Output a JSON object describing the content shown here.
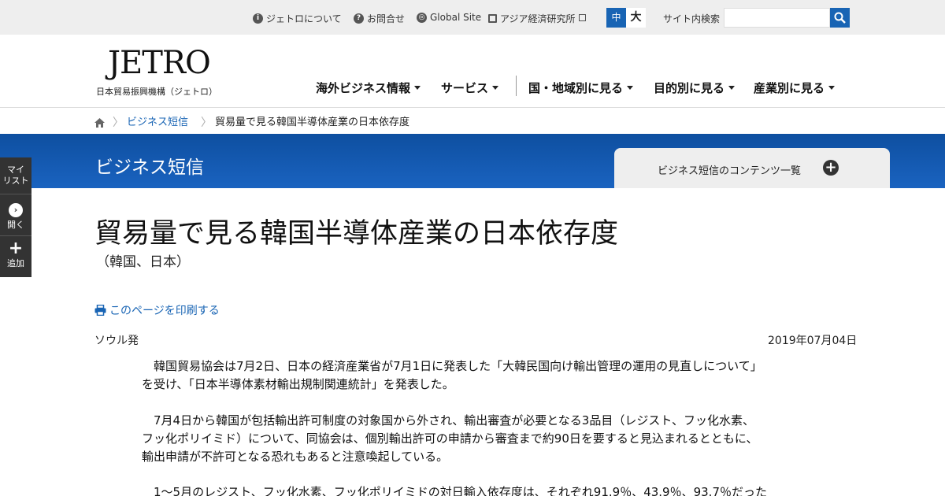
{
  "topbar": {
    "about": "ジェトロについて",
    "contact": "お問合せ",
    "global": "Global Site",
    "ide": "アジア経済研究所",
    "font_mid": "中",
    "font_big": "大",
    "search_label": "サイト内検索",
    "search_value": ""
  },
  "logo": {
    "word": "JETRO",
    "sub": "日本貿易振興機構（ジェトロ）"
  },
  "nav": [
    "海外ビジネス情報",
    "サービス",
    "国・地域別に見る",
    "目的別に見る",
    "産業別に見る"
  ],
  "breadcrumb": [
    "ビジネス短信",
    "貿易量で見る韓国半導体産業の日本依存度"
  ],
  "band": {
    "title": "ビジネス短信",
    "tab_label": "ビジネス短信のコンテンツ一覧"
  },
  "sidebar": {
    "mylist": [
      "マイ",
      "リスト"
    ],
    "open": "開く",
    "add": "追加"
  },
  "article": {
    "title": "貿易量で見る韓国半導体産業の日本依存度",
    "subtitle": "（韓国、日本）",
    "print": "このページを印刷する",
    "location": "ソウル発",
    "date": "2019年07月04日",
    "paragraphs": [
      [
        "　韓国貿易協会は7月2日、日本の経済産業省が7月1日に発表した「大韓民国向け輸出管理の運用の見直しについて」",
        "を受け、「日本半導体素材輸出規制関連統計」を発表した。"
      ],
      [
        "　7月4日から韓国が包括輸出許可制度の対象国から外され、輸出審査が必要となる3品目（レジスト、フッ化水素、",
        "フッ化ポリイミド）について、同協会は、個別輸出許可の申請から審査まで約90日を要すると見込まれるとともに、",
        "輸出申請が不許可となる恐れもあると注意喚起している。"
      ],
      [
        "　1～5月のレジスト、フッ化水素、フッ化ポリイミドの対日輸入依存度は、それぞれ91.9％、43.9％、93.7％だった"
      ]
    ]
  }
}
